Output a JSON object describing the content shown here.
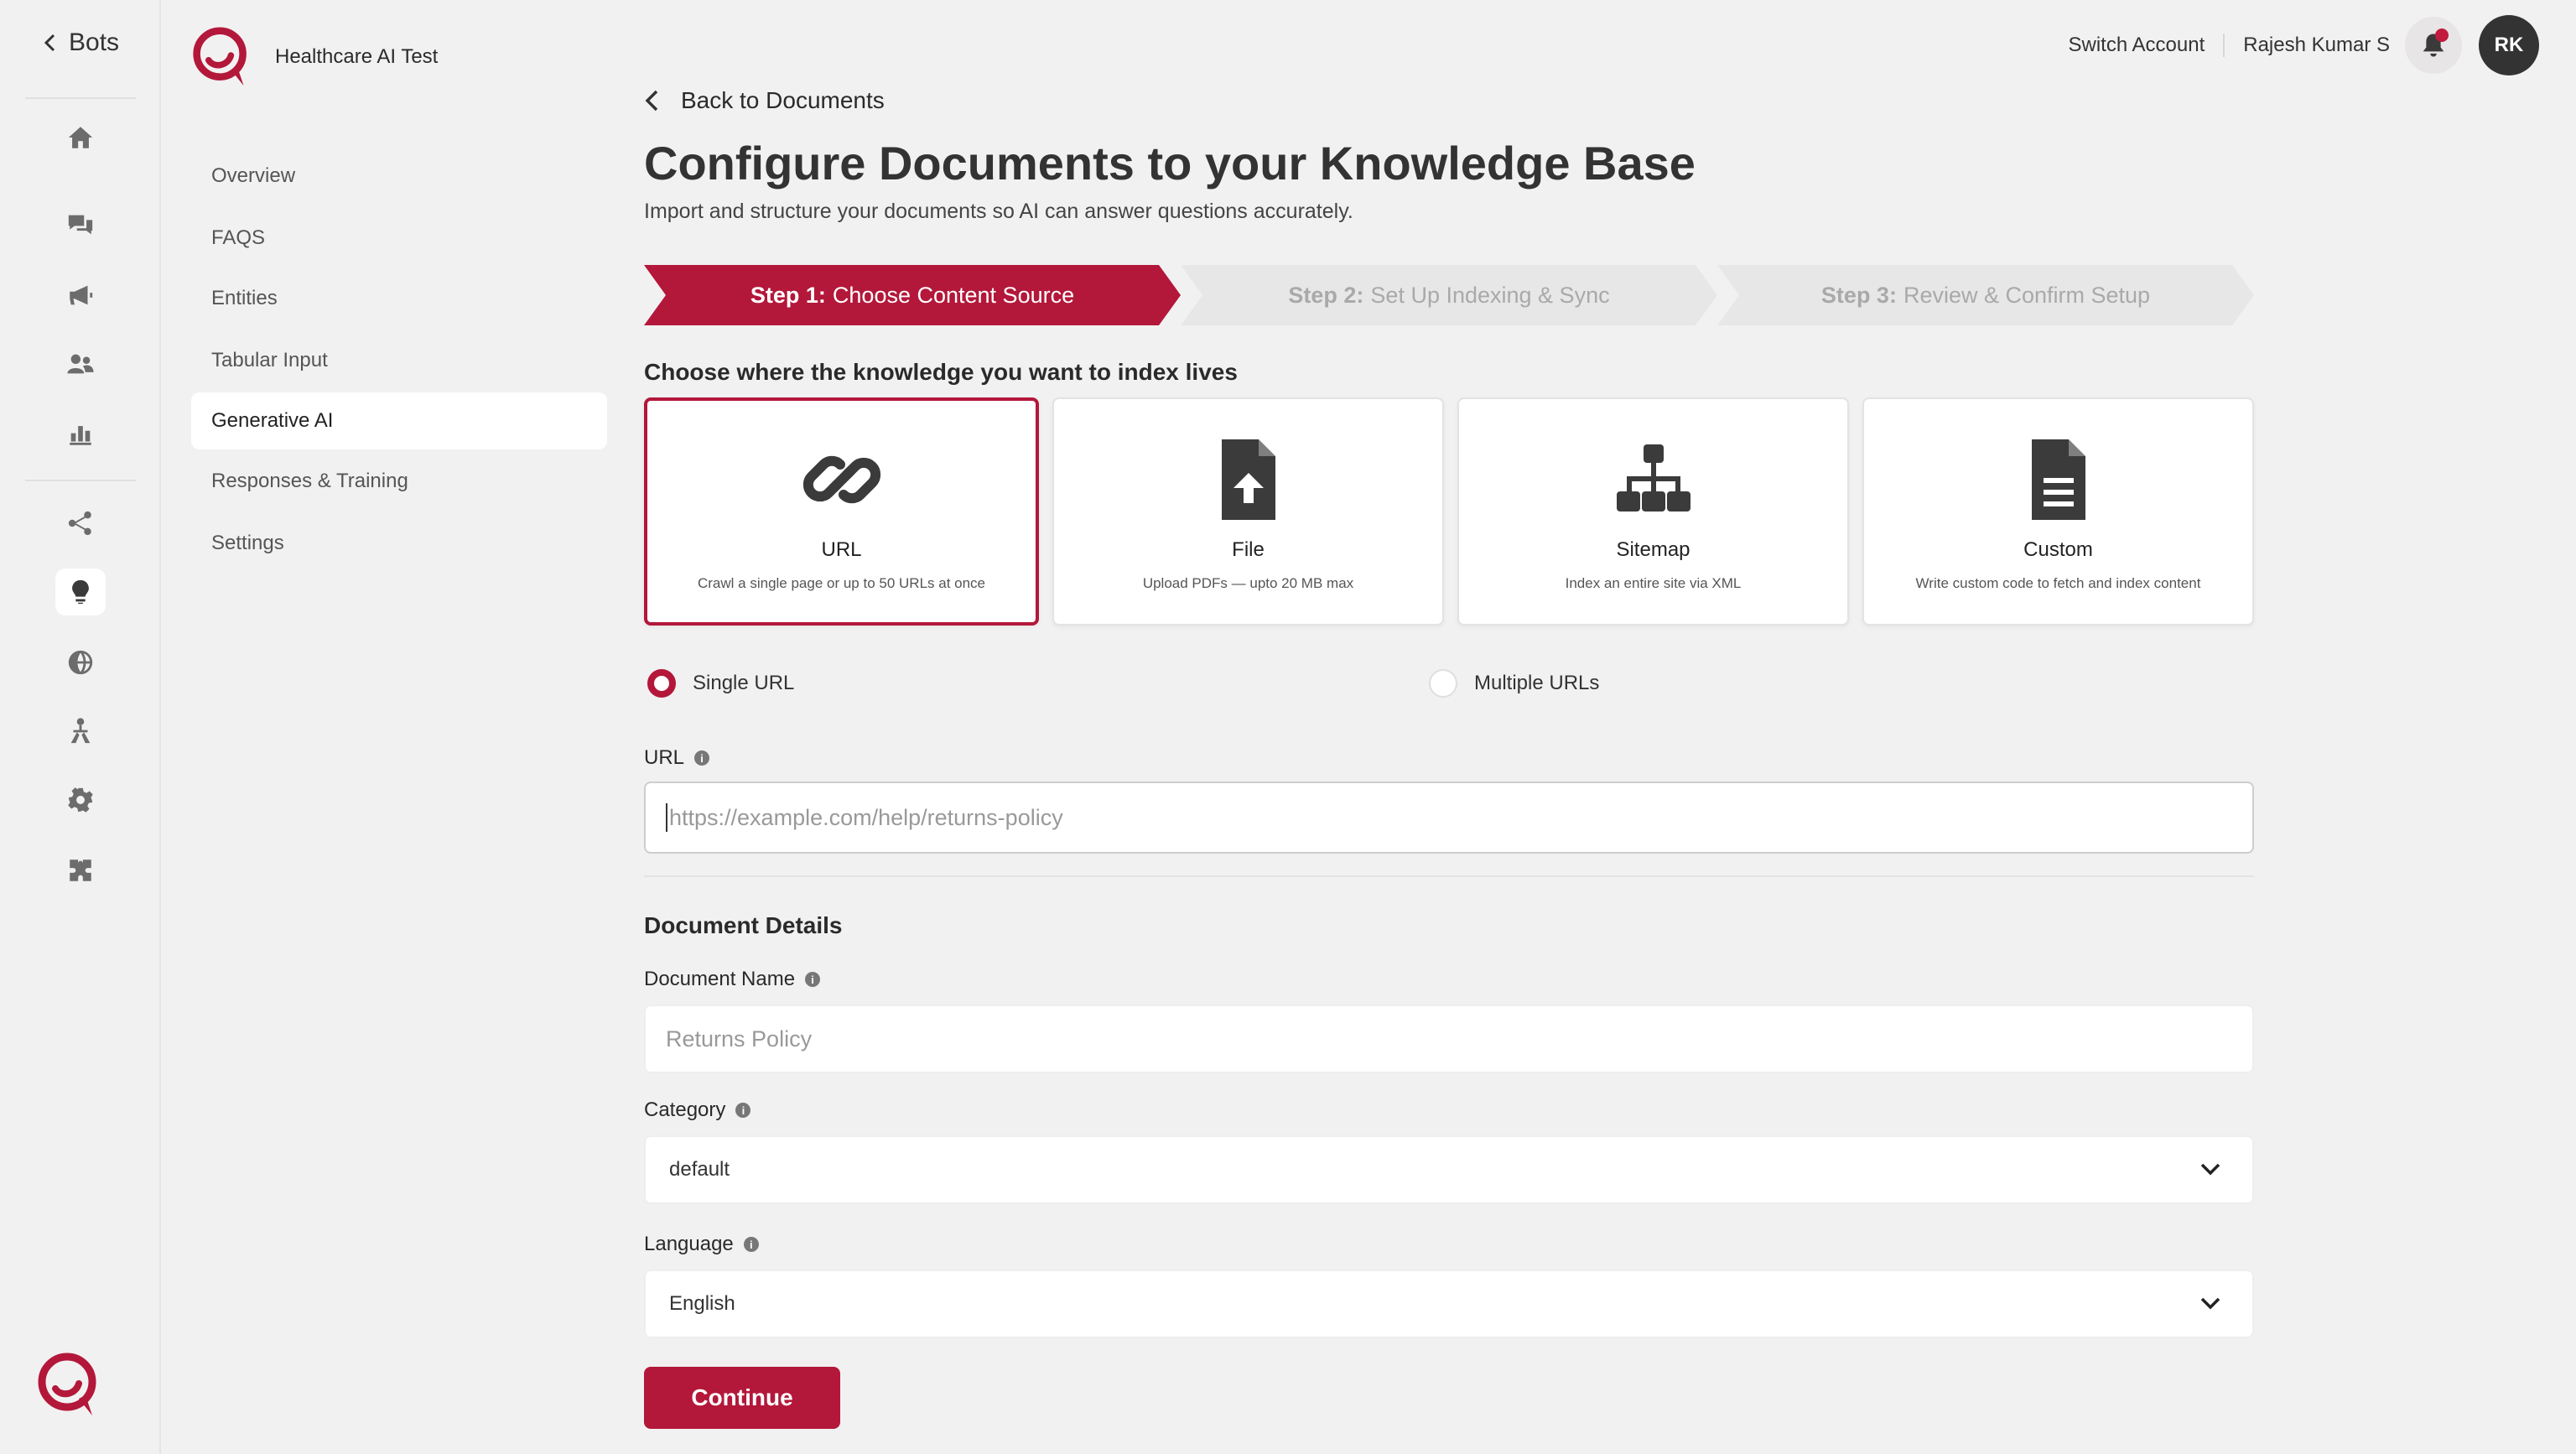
{
  "rail": {
    "back_label": "Bots",
    "icons": [
      "home-icon",
      "chat-icon",
      "megaphone-icon",
      "users-icon",
      "bar-chart-icon",
      "flow-icon",
      "bulb-icon",
      "globe-icon",
      "org-chart-icon",
      "gear-icon",
      "puzzle-icon"
    ]
  },
  "workspace": {
    "name": "Healthcare AI Test"
  },
  "subnav": {
    "items": [
      {
        "label": "Overview"
      },
      {
        "label": "FAQS"
      },
      {
        "label": "Entities"
      },
      {
        "label": "Tabular Input"
      },
      {
        "label": "Generative AI"
      },
      {
        "label": "Responses & Training"
      },
      {
        "label": "Settings"
      }
    ],
    "active_index": 4
  },
  "topbar": {
    "switch_account": "Switch Account",
    "user_name": "Rajesh Kumar S",
    "avatar_initials": "RK",
    "has_notification": true
  },
  "page": {
    "back_label": "Back to Documents",
    "title": "Configure Documents to your Knowledge Base",
    "subtitle": "Import and structure your documents so AI can answer questions accurately."
  },
  "stepper": {
    "steps": [
      {
        "prefix": "Step 1:",
        "label": "Choose Content Source",
        "state": "active"
      },
      {
        "prefix": "Step 2:",
        "label": "Set Up Indexing & Sync",
        "state": "inactive"
      },
      {
        "prefix": "Step 3:",
        "label": "Review & Confirm Setup",
        "state": "inactive"
      }
    ]
  },
  "source": {
    "heading": "Choose where the knowledge you want to index lives",
    "cards": [
      {
        "title": "URL",
        "desc": "Crawl a single page or up to 50 URLs at once",
        "icon": "link-icon",
        "selected": true
      },
      {
        "title": "File",
        "desc": "Upload PDFs — upto 20 MB max",
        "icon": "file-upload-icon",
        "selected": false
      },
      {
        "title": "Sitemap",
        "desc": "Index an entire site via XML",
        "icon": "sitemap-icon",
        "selected": false
      },
      {
        "title": "Custom",
        "desc": "Write custom code to fetch and index content",
        "icon": "document-icon",
        "selected": false
      }
    ],
    "modes": [
      {
        "label": "Single URL",
        "checked": true
      },
      {
        "label": "Multiple URLs",
        "checked": false
      }
    ]
  },
  "url_field": {
    "label": "URL",
    "placeholder": "https://example.com/help/returns-policy"
  },
  "details": {
    "heading": "Document Details",
    "name_label": "Document Name",
    "name_placeholder": "Returns Policy",
    "category_label": "Category",
    "category_value": "default",
    "language_label": "Language",
    "language_value": "English"
  },
  "actions": {
    "continue": "Continue"
  },
  "colors": {
    "accent": "#b3173a",
    "background": "#f2f1f1"
  }
}
